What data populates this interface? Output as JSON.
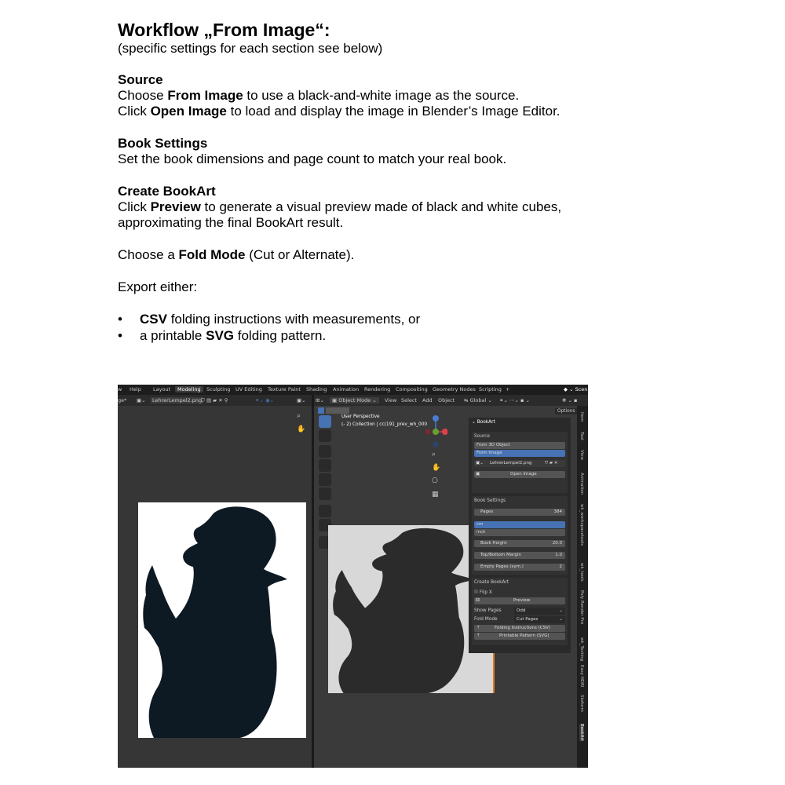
{
  "doc": {
    "title": "Workflow „From Image“:",
    "subtitle": "(specific settings for each section see below)",
    "source": {
      "heading": "Source",
      "line1_pre": "Choose ",
      "line1_bold": "From Image",
      "line1_post": " to use a black-and-white image as the source.",
      "line2_pre": "Click ",
      "line2_bold": "Open Image",
      "line2_post": " to load and display the image in Blender’s Image Editor."
    },
    "book_settings": {
      "heading": "Book Settings",
      "line1": "Set the book dimensions and page count to match your real book."
    },
    "create": {
      "heading": "Create BookArt",
      "line1_pre": "Click ",
      "line1_bold": "Preview",
      "line1_post": " to generate a visual preview made of black and white cubes,",
      "line2": "approximating the final BookArt result.",
      "fold_pre": "Choose a ",
      "fold_bold": "Fold Mode",
      "fold_post": " (Cut or Alternate).",
      "export": "Export either:"
    },
    "bullets": [
      {
        "dot": "•",
        "bold": "CSV",
        "pre": "",
        "post": " folding instructions with measurements, or"
      },
      {
        "dot": "•",
        "bold": "SVG",
        "pre": "a printable ",
        "post": " folding pattern."
      }
    ]
  },
  "blender": {
    "menu": [
      "w",
      "Help"
    ],
    "workspace_tabs": [
      "Layout",
      "Modeling",
      "Sculpting",
      "UV Editing",
      "Texture Paint",
      "Shading",
      "Animation",
      "Rendering",
      "Compositing",
      "Geometry Nodes",
      "Scripting",
      "+"
    ],
    "active_tab": "Modeling",
    "scene_label": "Scen",
    "image_editor": {
      "mode": "ge*",
      "image_name": "LehrerLempel2.png"
    },
    "viewport": {
      "mode": "Object Mode",
      "menus": [
        "View",
        "Select",
        "Add",
        "Object"
      ],
      "orientation": "Global",
      "options": "Options",
      "perspective": "User Perspective",
      "collection": "(- 2) Collection | cc(191_prev_wh_000"
    },
    "panel": {
      "title": "BookArt",
      "source_label": "Source",
      "source_options": [
        "From 3D Object",
        "From Image"
      ],
      "image_name": "LehrerLempel2.png",
      "open_image": "Open Image",
      "book_settings_label": "Book Settings",
      "pages_label": "Pages",
      "pages_value": "384",
      "units": [
        "cm",
        "inch"
      ],
      "book_height_label": "Book Height",
      "book_height_value": "20.0",
      "margin_label": "Top/Bottom Margin",
      "margin_value": "1.0",
      "empty_pages_label": "Empty Pages (sym.)",
      "empty_pages_value": "2",
      "create_label": "Create BookArt",
      "flip_x": "Flip X",
      "preview": "Preview",
      "show_pages_label": "Show Pages",
      "show_pages_value": "Odd",
      "fold_mode_label": "Fold Mode",
      "fold_mode_value": "Cut Pages",
      "csv_button": "Folding Instructions (CSV)",
      "svg_button": "Printable Pattern (SVG)"
    },
    "side_tabs": [
      "Item",
      "Tool",
      "View",
      "Animation",
      "wk_workspacetools",
      "wk_tools",
      "Poly Render Pro",
      "wk_Texting",
      "Easy HDRI",
      "Stoform",
      "BookArt"
    ],
    "colors": {
      "accent": "#4772b3",
      "silhouette": "#0d1a24",
      "preview_silhouette": "#2b2b2b",
      "plane": "#d8d8d8"
    }
  }
}
